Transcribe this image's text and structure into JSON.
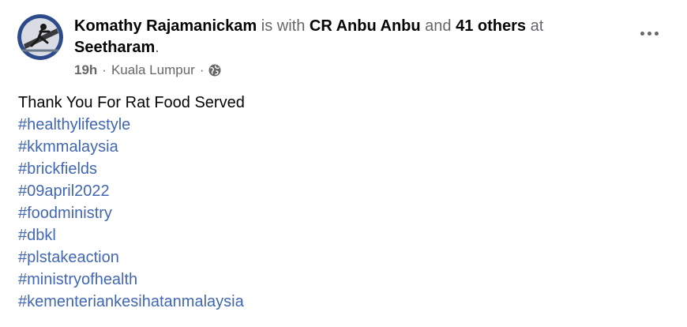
{
  "post": {
    "author": "Komathy Rajamanickam",
    "with_text": "is with",
    "tagged_person": "CR Anbu Anbu",
    "and_text": "and",
    "others": "41 others",
    "at_text": "at",
    "place": "Seetharam",
    "period": ".",
    "time": "19h",
    "separator": "·",
    "location": "Kuala Lumpur",
    "privacy_icon": "globe-icon",
    "more_icon": "more-options-icon",
    "message": "Thank You For Rat Food Served",
    "hashtags": [
      "#healthylifestyle",
      "#kkmmalaysia",
      "#brickfields",
      "#09april2022",
      "#foodministry",
      "#dbkl",
      "#plstakeaction",
      "#ministryofhealth",
      "#kementeriankesihatanmalaysia"
    ]
  },
  "colors": {
    "name": "#050505",
    "secondary": "#65676b",
    "link": "#4167b2",
    "background": "#ffffff"
  }
}
